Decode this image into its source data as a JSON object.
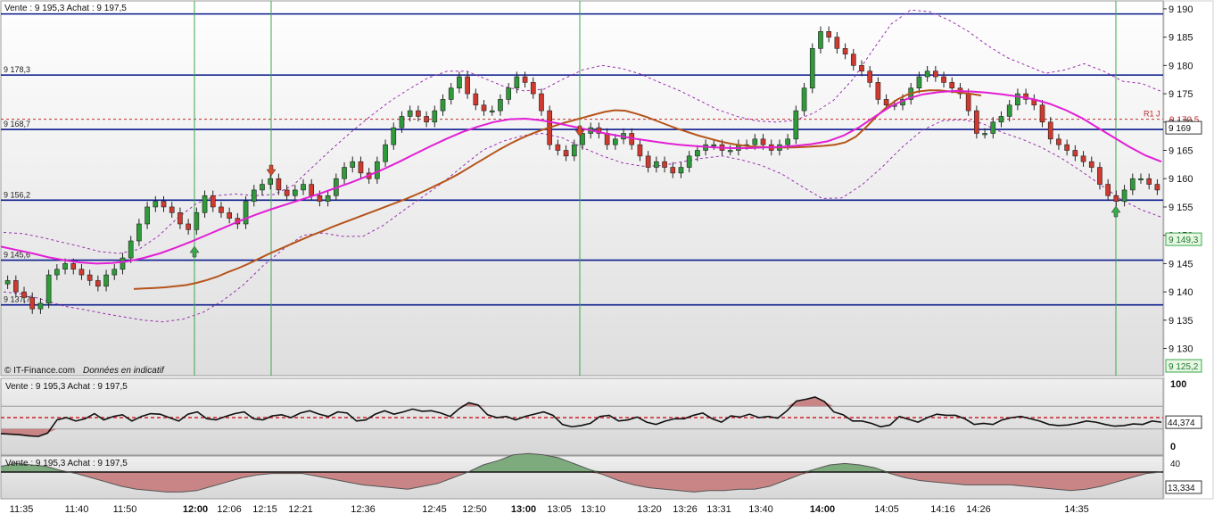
{
  "header_text": "Vente : 9 195,3 Achat : 9 197,5",
  "watermark": "© IT-Finance.com",
  "watermark_note": "Données en indicatif",
  "colors": {
    "bull": "#2f9a3a",
    "bear": "#d0392e",
    "level": "#0a1a8c",
    "ema": "#b5541a",
    "sma": "#e21fd5",
    "band": "#9a2fb0",
    "marker": "#3aa84b",
    "oscillator": "#111111",
    "osc_fill_pos": "#c98585",
    "osc_fill_green": "#7dab7d"
  },
  "x_labels": [
    "11:35",
    "11:40",
    "11:50",
    "12:00",
    "12:06",
    "12:15",
    "12:21",
    "12:36",
    "12:45",
    "12:50",
    "13:00",
    "13:05",
    "13:10",
    "13:20",
    "13:26",
    "13:31",
    "13:40",
    "14:00",
    "14:05",
    "14:16",
    "14:26",
    "14:35"
  ],
  "x_labels_bold": [
    "12:00",
    "13:00",
    "14:00"
  ],
  "chart_data": [
    {
      "type": "candlestick",
      "title": "",
      "y_ticks": [
        9130,
        9135,
        9140,
        9145,
        9150,
        9155,
        9160,
        9165,
        9170,
        9175,
        9180,
        9185,
        9190
      ],
      "y_tick_labels": [
        "9 130",
        "9 135",
        "9 140",
        "9 145",
        "9 150",
        "9 155",
        "9 160",
        "9 165",
        "9 170",
        "9 175",
        "9 180",
        "9 185",
        "9 190"
      ],
      "ylim": [
        9125.2,
        9190.3
      ],
      "levels": [
        {
          "value": 9189.1,
          "label": ""
        },
        {
          "value": 9178.3,
          "label": "9 178,3"
        },
        {
          "value": 9168.7,
          "label": "9 168,7"
        },
        {
          "value": 9156.2,
          "label": "9 156,2"
        },
        {
          "value": 9145.6,
          "label": "9 145,6"
        },
        {
          "value": 9137.7,
          "label": "9 137,7"
        }
      ],
      "pivot": {
        "value": 9170.5,
        "label": "R1 J",
        "price_label": "9 170,5"
      },
      "price_boxes": [
        {
          "value": 9169.0,
          "label": "9 169",
          "kind": "current"
        },
        {
          "value": 9149.3,
          "label": "9 149,3",
          "kind": "min"
        },
        {
          "value": 9125.2,
          "label": "9 125,2",
          "kind": "min"
        }
      ],
      "close_series_note": "",
      "closes": [
        9142,
        9140,
        9139,
        9137,
        9138,
        9143,
        9144,
        9145,
        9144,
        9143,
        9142,
        9141,
        9143,
        9144,
        9146,
        9149,
        9152,
        9155,
        9156,
        9155,
        9154,
        9152,
        9151,
        9154,
        9157,
        9155,
        9154,
        9153,
        9152,
        9156,
        9158,
        9159,
        9160,
        9158,
        9157,
        9158,
        9159,
        9157,
        9156,
        9157,
        9160,
        9162,
        9163,
        9161,
        9160,
        9163,
        9166,
        9169,
        9171,
        9172,
        9171,
        9170,
        9172,
        9174,
        9176,
        9178,
        9175,
        9173,
        9172,
        9172,
        9174,
        9176,
        9178,
        9177,
        9175,
        9172,
        9166,
        9165,
        9164,
        9166,
        9168,
        9169,
        9168,
        9166,
        9167,
        9168,
        9166,
        9164,
        9162,
        9163,
        9162,
        9161,
        9162,
        9164,
        9165,
        9166,
        9166,
        9165,
        9165,
        9166,
        9166,
        9167,
        9166,
        9165,
        9166,
        9167,
        9172,
        9176,
        9183,
        9186,
        9185,
        9183,
        9182,
        9180,
        9179,
        9177,
        9174,
        9173,
        9173,
        9174,
        9176,
        9178,
        9179,
        9178,
        9177,
        9176,
        9175,
        9172,
        9168,
        9168,
        9170,
        9171,
        9173,
        9175,
        9174,
        9173,
        9170,
        9167,
        9166,
        9165,
        9164,
        9163,
        9162,
        9159,
        9157,
        9156,
        9158,
        9160,
        9160,
        9159,
        9158
      ],
      "ema_values": [
        9140.5,
        9140.6,
        9140.7,
        9140.8,
        9141.0,
        9141.2,
        9141.6,
        9142.1,
        9142.7,
        9143.5,
        9144.2,
        9145.0,
        9145.9,
        9146.8,
        9147.6,
        9148.4,
        9149.2,
        9150.0,
        9150.7,
        9151.5,
        9152.2,
        9152.9,
        9153.6,
        9154.3,
        9155.0,
        9155.7,
        9156.4,
        9157.2,
        9158.0,
        9158.9,
        9159.8,
        9160.8,
        9161.9,
        9163.0,
        9164.1,
        9165.2,
        9166.2,
        9167.1,
        9167.9,
        9168.6,
        9169.2,
        9169.8,
        9170.3,
        9170.8,
        9171.3,
        9171.8,
        9172.1,
        9172.0,
        9171.5,
        9170.9,
        9170.2,
        9169.5,
        9168.8,
        9168.2,
        9167.6,
        9167.1,
        9166.6,
        9166.2,
        9165.9,
        9165.7,
        9165.6,
        9165.5,
        9165.5,
        9165.5,
        9165.6,
        9165.7,
        9165.8,
        9166.0,
        9166.4,
        9167.4,
        9169.1,
        9171.0,
        9172.7,
        9174.0,
        9174.9,
        9175.4,
        9175.6,
        9175.6,
        9175.4,
        9175.2,
        9175.0,
        9174.7
      ],
      "sma_values": [
        9148.0,
        9147.4,
        9146.8,
        9146.1,
        9145.6,
        9145.2,
        9145.0,
        9145.1,
        9145.4,
        9146.0,
        9146.8,
        9147.8,
        9148.9,
        9150.1,
        9151.3,
        9152.5,
        9153.6,
        9154.6,
        9155.5,
        9156.4,
        9157.3,
        9158.3,
        9159.3,
        9160.4,
        9161.6,
        9162.9,
        9164.3,
        9165.7,
        9167.0,
        9168.2,
        9169.2,
        9170.0,
        9170.5,
        9170.6,
        9170.3,
        9169.8,
        9169.2,
        9168.6,
        9168.0,
        9167.5,
        9167.0,
        9166.6,
        9166.2,
        9165.9,
        9165.7,
        9165.5,
        9165.4,
        9165.4,
        9165.5,
        9165.6,
        9165.8,
        9166.1,
        9166.6,
        9167.6,
        9169.1,
        9171.0,
        9172.8,
        9174.1,
        9174.9,
        9175.3,
        9175.5,
        9175.4,
        9175.2,
        9174.9,
        9174.5,
        9174.0,
        9173.2,
        9172.1,
        9170.7,
        9169.0,
        9167.3,
        9165.6,
        9164.1,
        9163.0
      ],
      "band_upper": [
        9150.5,
        9150.3,
        9149.6,
        9148.8,
        9148.0,
        9147.1,
        9146.8,
        9147.5,
        9149.8,
        9153.0,
        9155.6,
        9157.0,
        9157.3,
        9157.0,
        9157.2,
        9158.8,
        9162.0,
        9165.2,
        9168.2,
        9171.0,
        9173.6,
        9175.8,
        9177.8,
        9179.0,
        9179.0,
        9177.6,
        9176.2,
        9175.5,
        9175.8,
        9177.6,
        9179.2,
        9180.0,
        9179.5,
        9178.5,
        9177.0,
        9175.6,
        9173.9,
        9172.2,
        9171.0,
        9170.2,
        9170.0,
        9170.3,
        9171.6,
        9173.8,
        9177.5,
        9182.5,
        9187.3,
        9189.8,
        9189.5,
        9188.0,
        9186.0,
        9183.5,
        9181.4,
        9180.0,
        9178.6,
        9179.2,
        9180.3,
        9179.0,
        9177.2,
        9176.8,
        9175.4
      ],
      "band_lower": [
        9140.0,
        9139.6,
        9138.6,
        9137.5,
        9136.9,
        9136.2,
        9135.6,
        9135.0,
        9134.7,
        9135.2,
        9136.4,
        9138.5,
        9141.2,
        9144.6,
        9147.5,
        9150.0,
        9150.4,
        9149.8,
        9149.8,
        9151.7,
        9154.3,
        9156.8,
        9159.3,
        9162.2,
        9165.0,
        9166.6,
        9167.6,
        9168.0,
        9167.2,
        9165.5,
        9164.0,
        9162.8,
        9162.2,
        9162.3,
        9163.0,
        9163.6,
        9164.0,
        9163.3,
        9162.3,
        9160.8,
        9158.6,
        9156.5,
        9156.6,
        9158.9,
        9162.0,
        9165.5,
        9168.5,
        9170.2,
        9170.4,
        9169.8,
        9168.2,
        9167.0,
        9165.5,
        9163.6,
        9161.3,
        9158.8,
        9156.3,
        9154.5,
        9153.2
      ]
    },
    {
      "type": "line",
      "title": "Vente : 9 195,3 Achat : 9 197,5",
      "y_tick_labels": [
        "100",
        "0"
      ],
      "ylim": [
        0,
        100
      ],
      "reference_levels": [
        50,
        30,
        70
      ],
      "last_value_label": "44,374",
      "values": [
        22,
        21,
        20,
        18,
        17,
        23,
        46,
        50,
        44,
        48,
        57,
        46,
        52,
        55,
        44,
        52,
        57,
        56,
        50,
        44,
        56,
        60,
        48,
        46,
        52,
        57,
        60,
        48,
        46,
        53,
        55,
        50,
        58,
        62,
        56,
        52,
        60,
        58,
        44,
        46,
        56,
        62,
        56,
        60,
        65,
        61,
        62,
        58,
        52,
        66,
        76,
        72,
        55,
        50,
        52,
        46,
        52,
        56,
        60,
        54,
        38,
        34,
        36,
        40,
        52,
        54,
        44,
        46,
        51,
        42,
        38,
        44,
        48,
        48,
        54,
        58,
        48,
        42,
        53,
        51,
        56,
        50,
        52,
        49,
        62,
        79,
        82,
        86,
        78,
        60,
        55,
        44,
        44,
        40,
        34,
        37,
        52,
        47,
        42,
        50,
        56,
        54,
        54,
        48,
        38,
        40,
        38,
        46,
        50,
        52,
        48,
        44,
        38,
        36,
        37,
        40,
        44,
        42,
        38,
        35,
        36,
        39,
        38,
        44,
        42
      ]
    },
    {
      "type": "area",
      "title": "Vente : 9 195,3 Achat : 9 197,5",
      "y_tick_labels": [
        "40"
      ],
      "zero_line": 40,
      "last_value_label": "13,334",
      "values": [
        4,
        6,
        5,
        4,
        1,
        -1,
        -4,
        -7,
        -10,
        -12,
        -13,
        -14,
        -14,
        -13,
        -10,
        -7,
        -4,
        -2,
        -1,
        -1,
        -1,
        -3,
        -5,
        -7,
        -9,
        -10,
        -11,
        -12,
        -10,
        -8,
        -4,
        0,
        5,
        8,
        12,
        13,
        12,
        10,
        6,
        2,
        -2,
        -6,
        -9,
        -11,
        -12,
        -13,
        -14,
        -13,
        -13,
        -12,
        -12,
        -10,
        -6,
        -2,
        2,
        5,
        6,
        5,
        3,
        -1,
        -4,
        -6,
        -7,
        -8,
        -9,
        -9,
        -9,
        -9,
        -10,
        -11,
        -12,
        -13,
        -12,
        -10,
        -7,
        -4,
        -1,
        0
      ]
    }
  ]
}
